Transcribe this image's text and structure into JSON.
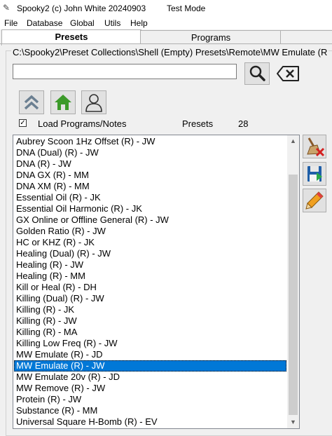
{
  "window": {
    "title": "Spooky2 (c) John White 20240903",
    "mode": "Test Mode"
  },
  "menu": [
    "File",
    "Database",
    "Global",
    "Utils",
    "Help"
  ],
  "tabs": [
    {
      "label": "Presets",
      "active": true
    },
    {
      "label": "Programs",
      "active": false
    }
  ],
  "path": {
    "label": "C:\\Spooky2\\Preset Collections\\Shell (Empty) Presets\\Remote\\MW Emulate (R"
  },
  "search": {
    "value": "",
    "placeholder": ""
  },
  "options": {
    "load_programs_label": "Load Programs/Notes",
    "load_programs_checked": true
  },
  "presets": {
    "label": "Presets",
    "count": "28",
    "selected_index": 20,
    "items": [
      "Aubrey Scoon 1Hz Offset (R) - JW",
      "DNA (Dual) (R) - JW",
      "DNA (R) - JW",
      "DNA GX (R) - MM",
      "DNA XM (R) - MM",
      "Essential Oil (R) - JK",
      "Essential Oil Harmonic (R) - JK",
      "GX Online or Offline General (R) - JW",
      "Golden Ratio (R) - JW",
      "HC or KHZ (R) - JK",
      "Healing (Dual) (R) - JW",
      "Healing (R) - JW",
      "Healing (R) - MM",
      "Kill or Heal (R) - DH",
      "Killing (Dual) (R) - JW",
      "Killing (R) - JK",
      "Killing (R) - JW",
      "Killing (R) - MA",
      "Killing Low Freq (R) - JW",
      "MW Emulate (R) - JD",
      "MW Emulate (R) - JW",
      "MW Emulate 20v (R) - JD",
      "MW Remove (R) - JW",
      "Protein (R) - JW",
      "Substance (R) - MM",
      "Universal Square H-Bomb (R) - EV"
    ]
  },
  "icons": {
    "search": "magnifier-icon",
    "clear": "backspace-icon",
    "up": "double-chevron-up-icon",
    "home": "home-icon",
    "user": "person-icon",
    "broom": "broom-delete-icon",
    "save": "floppy-save-icon",
    "edit": "pencil-icon"
  },
  "colors": {
    "selection": "#0078d7",
    "home_green": "#3c9a2a"
  }
}
